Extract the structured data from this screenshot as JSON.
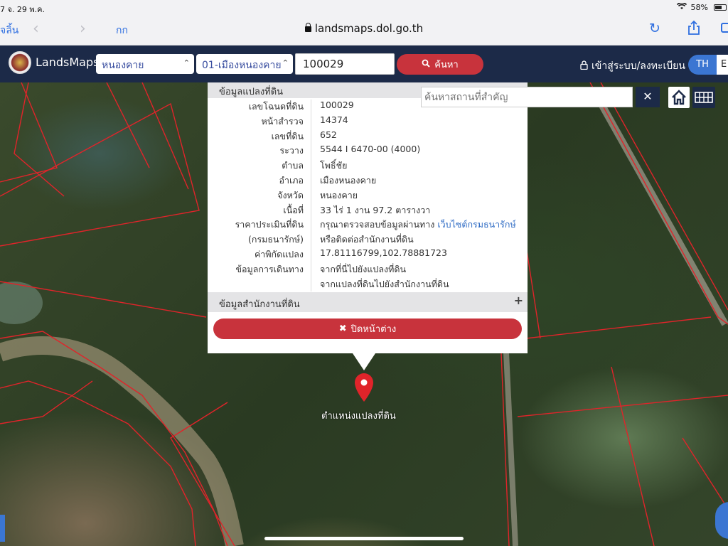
{
  "status_bar": {
    "left": "7 จ. 29 พ.ค.",
    "battery": "58%"
  },
  "browser": {
    "done_label": "จลิ้น",
    "text_size_label": "กก",
    "url": "landsmaps.dol.go.th"
  },
  "header": {
    "brand": "LandsMaps",
    "province_select": "หนองคาย",
    "district_select": "01-เมืองหนองคาย",
    "search_value": "100029",
    "search_button": "ค้นหา",
    "login_label": "เข้าสู่ระบบ/ลงทะเบียน",
    "lang_active": "TH",
    "lang_other": "E"
  },
  "landmark_search": {
    "placeholder": "ค้นหาสถานที่สำคัญ"
  },
  "popup": {
    "section_parcel": "ข้อมูลแปลงที่ดิน",
    "rows": [
      {
        "label": "เลขโฉนดที่ดิน",
        "value": "100029"
      },
      {
        "label": "หน้าสำรวจ",
        "value": "14374"
      },
      {
        "label": "เลขที่ดิน",
        "value": "652"
      },
      {
        "label": "ระวาง",
        "value": "5544 I 6470-00 (4000)"
      },
      {
        "label": "ตำบล",
        "value": "โพธิ์ชัย"
      },
      {
        "label": "อำเภอ",
        "value": "เมืองหนองคาย"
      },
      {
        "label": "จังหวัด",
        "value": "หนองคาย"
      },
      {
        "label": "เนื้อที่",
        "value": "33 ไร่ 1 งาน 97.2 ตารางวา"
      },
      {
        "label": "ราคาประเมินที่ดิน",
        "value": "กรุณาตรวจสอบข้อมูลผ่านทาง",
        "link": "เว็บไซต์กรมธนารักษ์"
      },
      {
        "label": "(กรมธนารักษ์)",
        "value": "หรือติดต่อสำนักงานที่ดิน"
      },
      {
        "label": "ค่าพิกัดแปลง",
        "link": "17.81116799,102.78881723"
      },
      {
        "label": "ข้อมูลการเดินทาง",
        "link": "จากที่นี่ไปยังแปลงที่ดิน"
      },
      {
        "label": "",
        "link": "จากแปลงที่ดินไปยังสำนักงานที่ดิน"
      }
    ],
    "section_office": "ข้อมูลสำนักงานที่ดิน",
    "close_button": "ปิดหน้าต่าง"
  },
  "map": {
    "pin_label": "ตำแหน่งแปลงที่ดิน",
    "boundary_color": "#e0242a"
  }
}
